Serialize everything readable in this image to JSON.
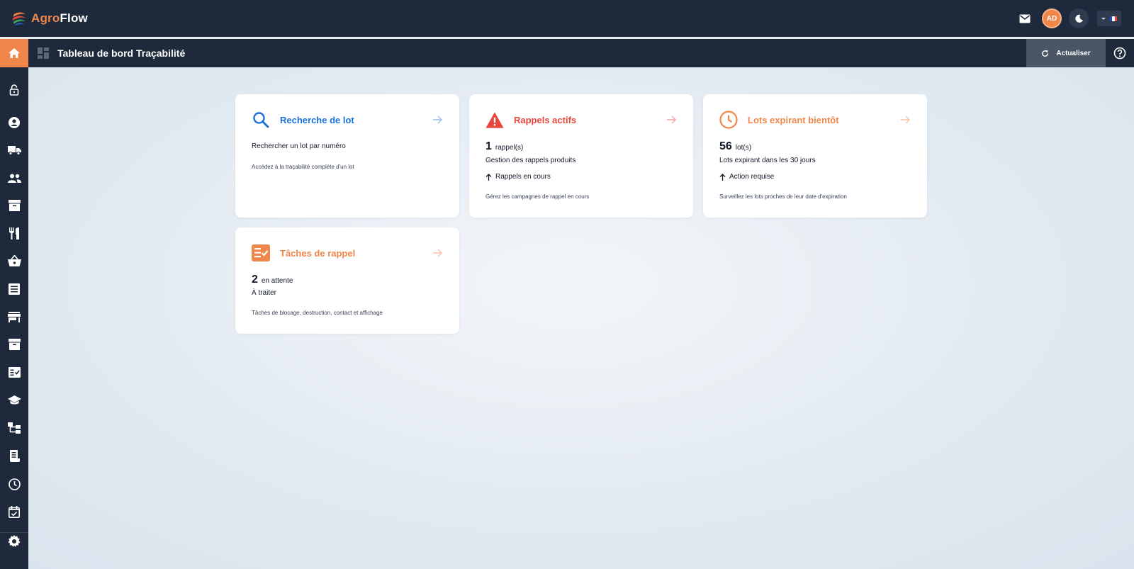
{
  "app": {
    "name_part1": "Agro",
    "name_part2": "Flow"
  },
  "topbar": {
    "avatar_initials": "AD",
    "icons": [
      "mail-icon",
      "moon-icon",
      "chevron-down-icon",
      "french-flag-icon"
    ]
  },
  "header": {
    "title": "Tableau de bord Traçabilité",
    "refresh_label": "Actualiser"
  },
  "sidebar": {
    "items": [
      "lock-open-icon",
      "account-circle-icon",
      "truck-icon",
      "people-icon",
      "inventory-icon",
      "restaurant-icon",
      "basket-icon",
      "list-icon",
      "store-icon",
      "archive-icon",
      "checklist-icon",
      "school-icon",
      "hierarchy-icon",
      "receipt-icon",
      "clock-icon",
      "event-check-icon",
      "settings-icon"
    ]
  },
  "colors": {
    "brand_dark": "#1e2a3b",
    "accent_orange": "#f0864a",
    "blue": "#1a6fd8",
    "red": "#e8453c"
  },
  "cards": [
    {
      "title": "Recherche de lot",
      "line1": "Rechercher un lot par numéro",
      "footer": "Accédez à la traçabilité complète d'un lot"
    },
    {
      "title": "Rappels actifs",
      "count": "1",
      "unit": "rappel(s)",
      "subtitle": "Gestion des rappels produits",
      "trend": "Rappels en cours",
      "footer": "Gérez les campagnes de rappel en cours"
    },
    {
      "title": "Lots expirant bientôt",
      "count": "56",
      "unit": "lot(s)",
      "subtitle": "Lots expirant dans les 30 jours",
      "trend": "Action requise",
      "footer": "Surveillez les lots proches de leur date d'expiration"
    },
    {
      "title": "Tâches de rappel",
      "count": "2",
      "unit": "en attente",
      "subtitle": "À traiter",
      "footer": "Tâches de blocage, destruction, contact et affichage"
    }
  ]
}
